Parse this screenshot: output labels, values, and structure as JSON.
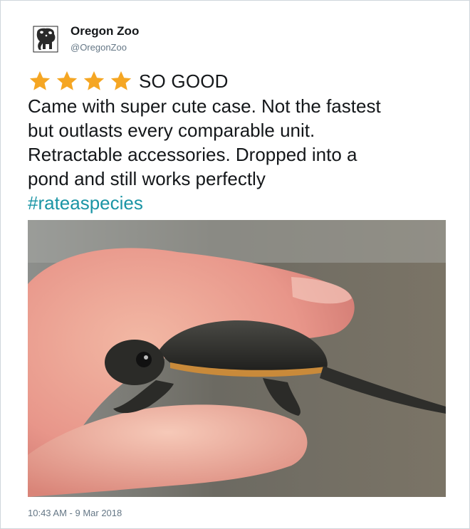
{
  "account": {
    "name": "Oregon Zoo",
    "handle": "@OregonZoo",
    "avatar_icon": "elephant-logo-icon"
  },
  "rating": {
    "stars": 4,
    "max_stars": 4,
    "label": "SO GOOD",
    "star_color": "#f5a623"
  },
  "post": {
    "lines": [
      "Came with super cute case. Not the fastest",
      "but outlasts every comparable unit.",
      "Retractable accessories. Dropped into a",
      "pond and still works perfectly"
    ],
    "hashtag": "#rateaspecies",
    "hashtag_color": "#1b95a5"
  },
  "media": {
    "subject_icon": "baby-turtle-on-finger-photo"
  },
  "meta": {
    "timestamp": "10:43 AM - 9 Mar 2018"
  }
}
